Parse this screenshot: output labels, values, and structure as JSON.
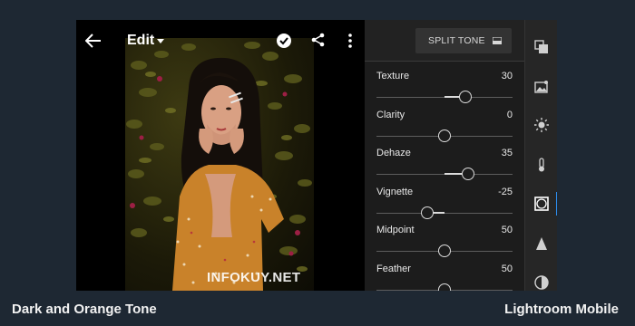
{
  "topbar": {
    "edit_label": "Edit",
    "icons": [
      "back-arrow-icon",
      "chevron-down-icon",
      "check-circle-icon",
      "share-icon",
      "more-vert-icon"
    ]
  },
  "photo": {
    "watermark": "INFOKUY.NET"
  },
  "panel": {
    "split_tone_label": "SPLIT TONE",
    "sliders": [
      {
        "label": "Texture",
        "value": "30",
        "position": 0.65,
        "center": 0.5
      },
      {
        "label": "Clarity",
        "value": "0",
        "position": 0.5,
        "center": 0.5
      },
      {
        "label": "Dehaze",
        "value": "35",
        "position": 0.675,
        "center": 0.5
      },
      {
        "label": "Vignette",
        "value": "-25",
        "position": 0.375,
        "center": 0.5
      },
      {
        "label": "Midpoint",
        "value": "50",
        "position": 0.5,
        "center": 0.5
      },
      {
        "label": "Feather",
        "value": "50",
        "position": 0.5,
        "center": 0.5
      }
    ]
  },
  "toolbar": {
    "tools": [
      "presets-icon",
      "image-adjust-icon",
      "light-icon",
      "color-temperature-icon",
      "effects-icon",
      "detail-icon",
      "optics-icon"
    ],
    "active": "effects-icon",
    "accent": "#2d8ceb"
  },
  "captions": {
    "left": "Dark and Orange Tone",
    "right": "Lightroom Mobile"
  }
}
